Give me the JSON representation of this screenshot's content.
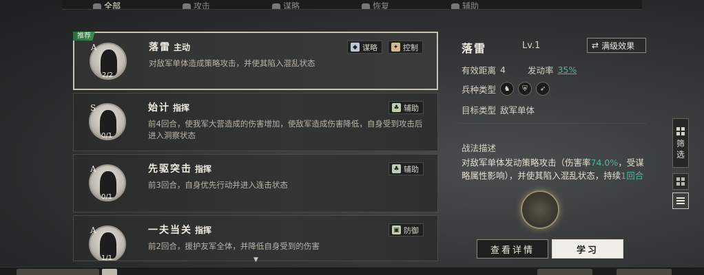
{
  "tabs": [
    {
      "label": "全部",
      "icon": "all-icon",
      "active": true
    },
    {
      "label": "攻击",
      "icon": "sword-icon",
      "active": false
    },
    {
      "label": "谋略",
      "icon": "scroll-icon",
      "active": false
    },
    {
      "label": "恢复",
      "icon": "heal-icon",
      "active": false
    },
    {
      "label": "辅助",
      "icon": "support-icon",
      "active": false
    }
  ],
  "skills": [
    {
      "badge": "推荐",
      "grade": "A",
      "count": "2/2",
      "name": "落雷",
      "kind": "主动",
      "desc": "对敌军单体造成策略攻击，并使其陷入混乱状态",
      "tags": [
        {
          "label": "谋略",
          "icon": "strategy-icon"
        },
        {
          "label": "控制",
          "icon": "control-icon"
        }
      ]
    },
    {
      "grade": "S",
      "count": "0/1",
      "name": "始计",
      "kind": "指挥",
      "desc": "前4回合，使我军大营造成的伤害增加，使敌军造成伤害降低，自身受到攻击后进入洞察状态",
      "tags": [
        {
          "label": "辅助",
          "icon": "support-tag-icon"
        }
      ]
    },
    {
      "grade": "A",
      "count": "0/1",
      "name": "先驱突击",
      "kind": "指挥",
      "desc": "前3回合，自身优先行动并进入连击状态",
      "tags": [
        {
          "label": "辅助",
          "icon": "support-tag-icon"
        }
      ]
    },
    {
      "grade": "A",
      "count": "1/1",
      "name": "一夫当关",
      "kind": "指挥",
      "desc": "前2回合，援护友军全体，并降低自身受到的伤害",
      "tags": [
        {
          "label": "防御",
          "icon": "defense-icon"
        }
      ]
    }
  ],
  "detail": {
    "name": "落雷",
    "level": "Lv.1",
    "max_effect_label": "满级效果",
    "range_label": "有效距离",
    "range_value": "4",
    "rate_label": "发动率",
    "rate_value": "35%",
    "troop_label": "兵种类型",
    "target_label": "目标类型",
    "target_value": "敌军单体",
    "desc_title": "战法描述",
    "desc_part1": "对敌军单体发动策略攻击（伤害率",
    "desc_rate": "74.0%",
    "desc_part2": "，受谋略属性影响），并使其陷入混乱状态，持续",
    "desc_turns": "1回合",
    "view_detail_label": "查看详情",
    "learn_label": "学习"
  },
  "side": {
    "filter_label_1": "筛",
    "filter_label_2": "选"
  }
}
